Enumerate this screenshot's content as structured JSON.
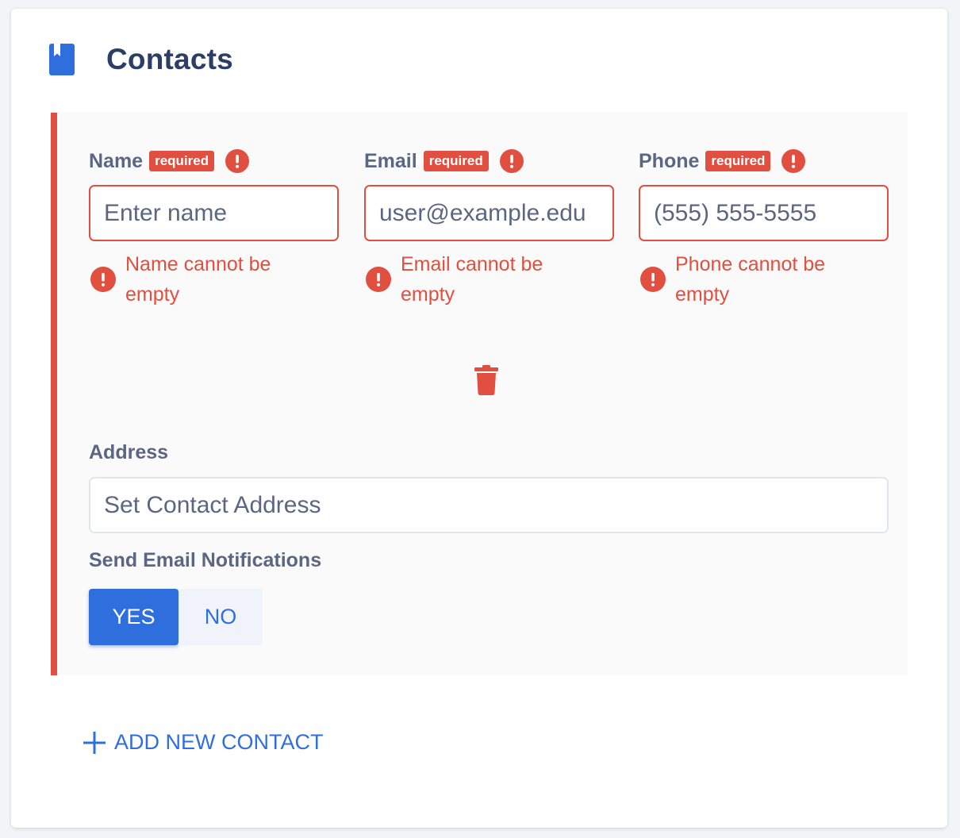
{
  "header": {
    "title": "Contacts",
    "icon": "book-icon"
  },
  "colors": {
    "accent": "#2f6fdd",
    "error": "#e04f3f",
    "title": "#2c3e66",
    "label": "#5b6683"
  },
  "contact": {
    "fields": {
      "name": {
        "label": "Name",
        "badge": "required",
        "placeholder": "Enter name",
        "error": "Name cannot be empty"
      },
      "email": {
        "label": "Email",
        "badge": "required",
        "placeholder": "user@example.edu",
        "error": "Email cannot be empty"
      },
      "phone": {
        "label": "Phone",
        "badge": "required",
        "placeholder": "(555) 555-5555",
        "error": "Phone cannot be empty"
      }
    },
    "delete_icon": "trash-icon",
    "address": {
      "label": "Address",
      "placeholder": "Set Contact Address"
    },
    "notifications": {
      "label": "Send Email Notifications",
      "yes": "YES",
      "no": "NO",
      "selected": "YES"
    }
  },
  "add_contact": {
    "label": "ADD NEW CONTACT",
    "icon": "plus-icon"
  }
}
